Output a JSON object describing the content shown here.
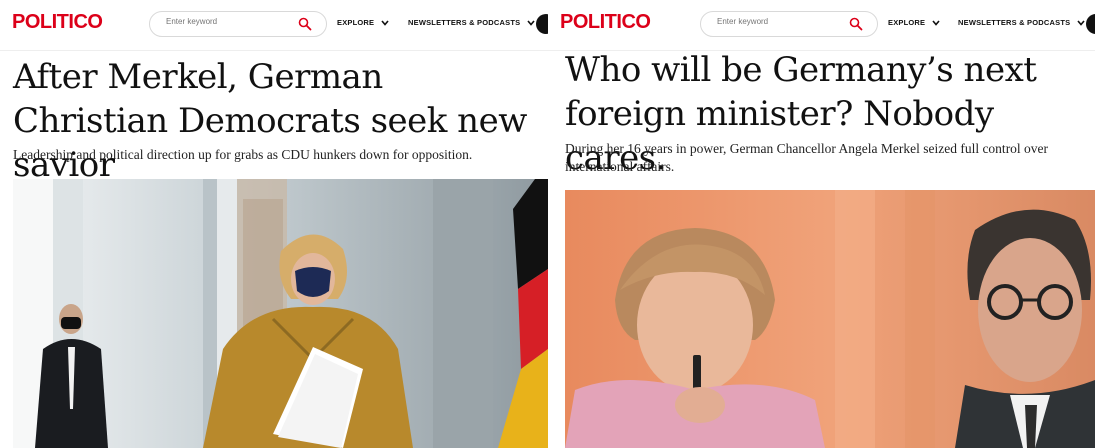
{
  "left_article": {
    "nav": {
      "logo": "POLITICO",
      "search_placeholder": "Enter keyword",
      "explore": "EXPLORE",
      "newsletters": "NEWSLETTERS & PODCASTS"
    },
    "headline": "After Merkel, German Christian Democrats seek new savior",
    "dek": "Leadership and political direction up for grabs as CDU hunkers down for opposition."
  },
  "right_article": {
    "nav": {
      "logo": "POLITICO",
      "search_placeholder": "Enter keyword",
      "explore": "EXPLORE",
      "newsletters": "NEWSLETTERS & PODCASTS"
    },
    "headline": "Who will be Germany’s next foreign minister? Nobody cares.",
    "dek": "During her 16 years in power, German Chancellor Angela Merkel seized full control over international affairs."
  },
  "colors": {
    "brand_red": "#dc0019",
    "text": "#111111",
    "search_border": "#d9d9d9"
  },
  "icons": [
    "search-icon",
    "chevron-down-icon"
  ]
}
